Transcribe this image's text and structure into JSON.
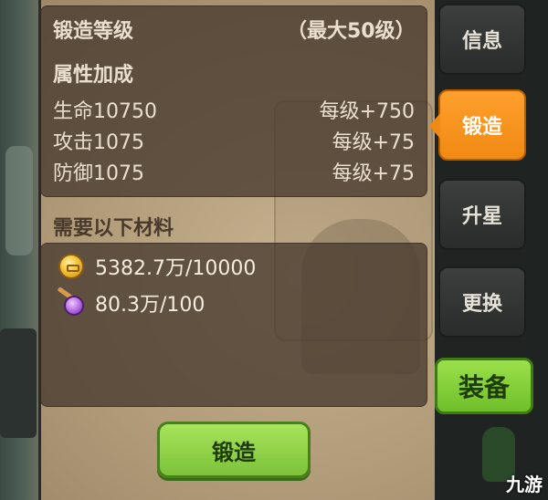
{
  "attributes_panel": {
    "forge_level_label": "锻造等级",
    "max_level_note": "（最大50级）",
    "bonus_title": "属性加成",
    "rows": [
      {
        "stat": "生命10750",
        "per_level": "每级+750"
      },
      {
        "stat": "攻击1075",
        "per_level": "每级+75"
      },
      {
        "stat": "防御1075",
        "per_level": "每级+75"
      }
    ]
  },
  "materials_panel": {
    "title": "需要以下材料",
    "items": [
      {
        "icon": "gold-coin-icon",
        "amount": "5382.7万/10000"
      },
      {
        "icon": "purple-potion-icon",
        "amount": "80.3万/100"
      }
    ]
  },
  "forge_button_label": "锻造",
  "side_tabs": [
    {
      "label": "信息",
      "active": false
    },
    {
      "label": "锻造",
      "active": true
    },
    {
      "label": "升星",
      "active": false
    },
    {
      "label": "更换",
      "active": false
    }
  ],
  "equip_button_label": "装备",
  "watermark": "九游",
  "colors": {
    "active_tab": "#f08a12",
    "green_button": "#7cc23a",
    "panel_bg": "#483a2e",
    "text": "#eadfcf"
  }
}
